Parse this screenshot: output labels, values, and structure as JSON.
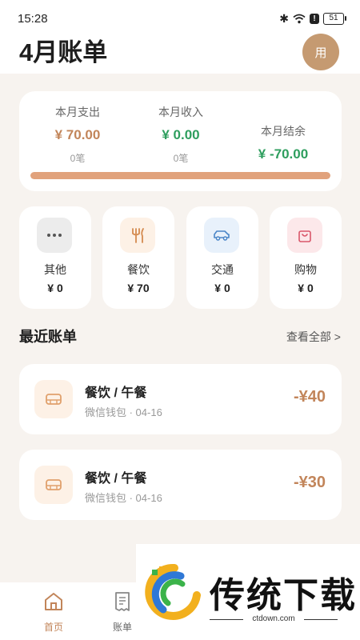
{
  "status_bar": {
    "time": "15:28",
    "battery": "51"
  },
  "header": {
    "title": "4月账单",
    "avatar_text": "用"
  },
  "summary": {
    "expense": {
      "label": "本月支出",
      "value": "¥ 70.00",
      "count": "0笔"
    },
    "income": {
      "label": "本月收入",
      "value": "¥ 0.00",
      "count": "0笔"
    },
    "balance": {
      "label": "本月结余",
      "value": "¥ -70.00"
    },
    "progress_fraction": 1.0
  },
  "categories": [
    {
      "name": "其他",
      "amount": "¥ 0",
      "icon": "more-dots-icon"
    },
    {
      "name": "餐饮",
      "amount": "¥ 70",
      "icon": "fork-knife-icon"
    },
    {
      "name": "交通",
      "amount": "¥ 0",
      "icon": "car-icon"
    },
    {
      "name": "购物",
      "amount": "¥ 0",
      "icon": "shopping-bag-icon"
    }
  ],
  "recent": {
    "title": "最近账单",
    "view_all": "查看全部 >",
    "items": [
      {
        "title": "餐饮 / 午餐",
        "meta": "微信钱包 · 04-16",
        "amount": "-¥40",
        "icon": "food-box-icon"
      },
      {
        "title": "餐饮 / 午餐",
        "meta": "微信钱包 · 04-16",
        "amount": "-¥30",
        "icon": "food-box-icon"
      }
    ]
  },
  "bottom_nav": [
    {
      "label": "首页",
      "icon": "home-icon",
      "active": true
    },
    {
      "label": "账单",
      "icon": "receipt-icon",
      "active": false
    }
  ],
  "watermark": {
    "text": "传统下载",
    "url": "ctdown.com"
  },
  "colors": {
    "accent": "#c2855a",
    "income_green": "#2e9e5e",
    "background": "#f7f3ef",
    "avatar": "#c59a71"
  }
}
